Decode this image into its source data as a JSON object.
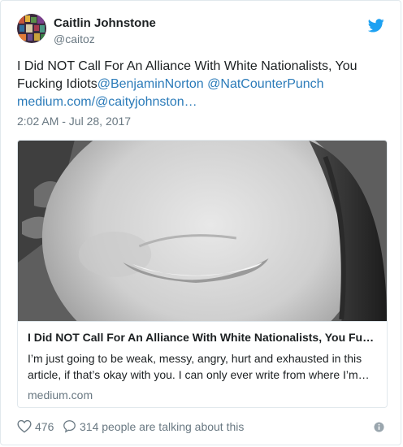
{
  "user": {
    "display_name": "Caitlin Johnstone",
    "handle": "@caitoz"
  },
  "tweet": {
    "text_line1": "I Did NOT Call For An Alliance With White Nationalists, You",
    "text_line2": "Fucking Idiots",
    "mention1": "@BenjaminNorton",
    "mention2": "@NatCounterPunch",
    "link": "medium.com/@caityjohnston…",
    "timestamp": "2:02 AM - Jul 28, 2017"
  },
  "card": {
    "title": "I Did NOT Call For An Alliance With White Nationalists, You Fu…",
    "description": "I’m just going to be weak, messy, angry, hurt and exhausted in this article, if that’s okay with you. I can only ever write from where I’m…",
    "domain": "medium.com"
  },
  "footer": {
    "like_count": "476",
    "talking": "314 people are talking about this"
  },
  "icons": {
    "brand": "twitter-bird-icon",
    "like": "heart-icon",
    "reply": "reply-bubble-icon",
    "info": "info-icon"
  },
  "colors": {
    "link": "#2b7bb9",
    "twitter_blue": "#1da1f2",
    "muted": "#697882",
    "text": "#1c2022",
    "border": "#e1e8ed"
  }
}
